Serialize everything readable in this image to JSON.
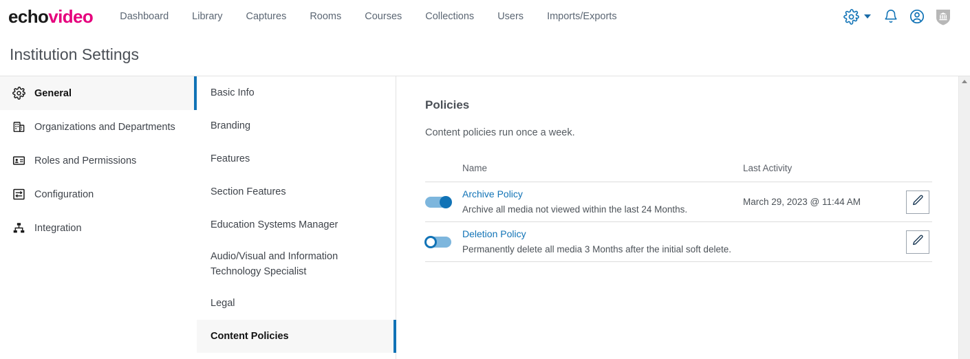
{
  "brand": {
    "logo_primary": "echo",
    "logo_secondary": "video",
    "logo_primary_color": "#1a1a1a",
    "logo_secondary_color": "#e5007d",
    "accent_color": "#1173b6"
  },
  "topnav": {
    "links": [
      {
        "label": "Dashboard"
      },
      {
        "label": "Library"
      },
      {
        "label": "Captures"
      },
      {
        "label": "Rooms"
      },
      {
        "label": "Courses"
      },
      {
        "label": "Collections"
      },
      {
        "label": "Users"
      },
      {
        "label": "Imports/Exports"
      }
    ],
    "icons": [
      {
        "name": "gear-icon"
      },
      {
        "name": "chevron-down-icon"
      },
      {
        "name": "bell-icon"
      },
      {
        "name": "user-account-icon"
      },
      {
        "name": "institution-shield-icon"
      }
    ]
  },
  "page": {
    "title": "Institution Settings"
  },
  "sidebar": {
    "items": [
      {
        "label": "General",
        "icon": "gear-icon",
        "active": true
      },
      {
        "label": "Organizations and Departments",
        "icon": "building-icon",
        "active": false
      },
      {
        "label": "Roles and Permissions",
        "icon": "id-card-icon",
        "active": false
      },
      {
        "label": "Configuration",
        "icon": "sliders-icon",
        "active": false
      },
      {
        "label": "Integration",
        "icon": "sitemap-icon",
        "active": false
      }
    ]
  },
  "submenu": {
    "items": [
      {
        "label": "Basic Info",
        "active": false
      },
      {
        "label": "Branding",
        "active": false
      },
      {
        "label": "Features",
        "active": false
      },
      {
        "label": "Section Features",
        "active": false
      },
      {
        "label": "Education Systems Manager",
        "active": false
      },
      {
        "label": "Audio/Visual and Information Technology Specialist",
        "active": false
      },
      {
        "label": "Legal",
        "active": false
      },
      {
        "label": "Content Policies",
        "active": true
      }
    ]
  },
  "main": {
    "heading": "Policies",
    "subheading": "Content policies run once a week.",
    "table": {
      "columns": {
        "name": "Name",
        "last_activity": "Last Activity"
      },
      "rows": [
        {
          "enabled": true,
          "toggle_state": "on",
          "name": "Archive Policy",
          "description": "Archive all media not viewed within the last 24 Months.",
          "last_activity": "March 29, 2023 @ 11:44 AM",
          "edit_icon": "pencil-icon"
        },
        {
          "enabled": false,
          "toggle_state": "off",
          "name": "Deletion Policy",
          "description": "Permanently delete all media 3 Months after the initial soft delete.",
          "last_activity": "",
          "edit_icon": "pencil-icon"
        }
      ]
    }
  },
  "scrollbar": {
    "up_arrow": "scroll-up-arrow"
  }
}
